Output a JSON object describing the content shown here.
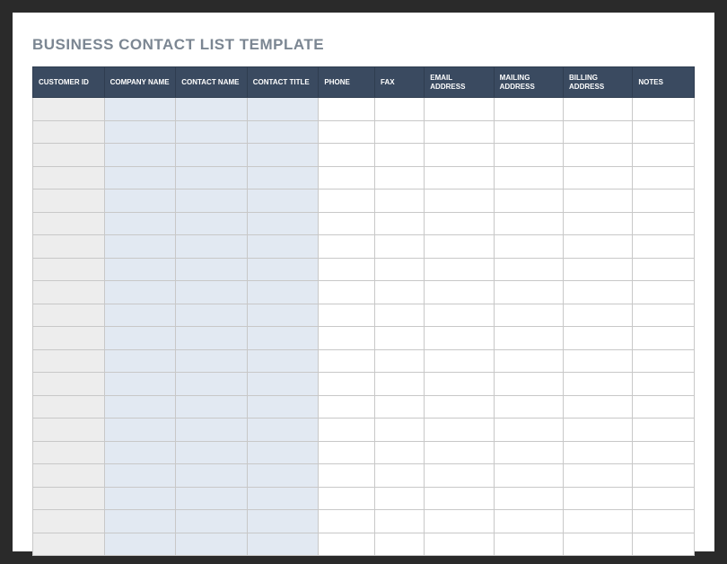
{
  "title": "BUSINESS CONTACT LIST TEMPLATE",
  "columns": [
    {
      "label": "CUSTOMER ID"
    },
    {
      "label": "COMPANY NAME"
    },
    {
      "label": "CONTACT NAME"
    },
    {
      "label": "CONTACT TITLE"
    },
    {
      "label": "PHONE"
    },
    {
      "label": "FAX"
    },
    {
      "label": "EMAIL ADDRESS"
    },
    {
      "label": "MAILING ADDRESS"
    },
    {
      "label": "BILLING ADDRESS"
    },
    {
      "label": "NOTES"
    }
  ],
  "row_count": 20,
  "colors": {
    "header_bg": "#3a4a60",
    "header_text": "#ffffff",
    "id_col_bg": "#ededed",
    "blue_col_bg": "#e2e9f2",
    "white_col_bg": "#ffffff",
    "title_text": "#7b8692",
    "frame_bg": "#2a2a2a"
  }
}
